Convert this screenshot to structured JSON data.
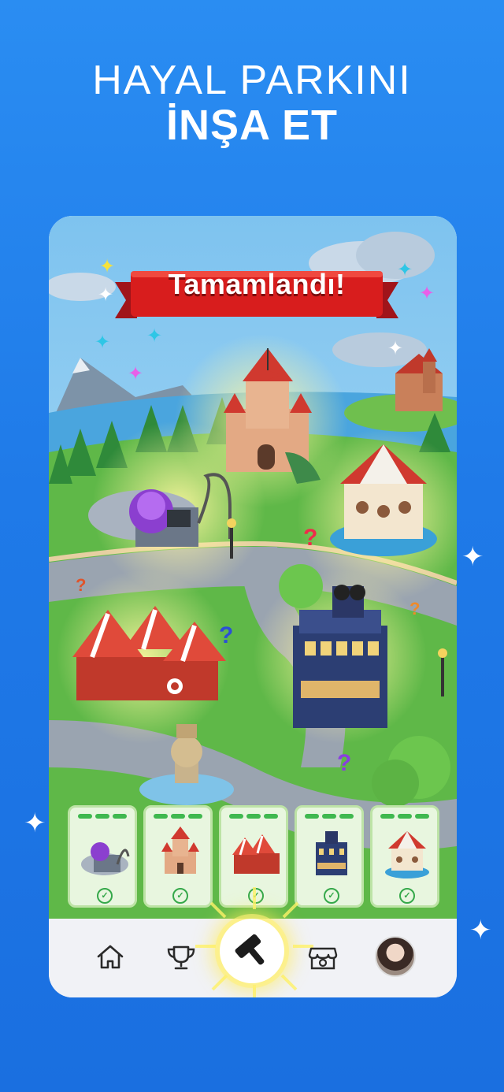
{
  "headline": {
    "line1": "HAYAL PARKINI",
    "line2": "İNŞA ET"
  },
  "game": {
    "banner_text": "Tamamlandı!",
    "question_mark": "?"
  },
  "cards": [
    {
      "name": "Bilim Laboratuvarı",
      "status": "completed"
    },
    {
      "name": "Kale",
      "status": "completed"
    },
    {
      "name": "Sirk Çadırları",
      "status": "completed"
    },
    {
      "name": "Sinema Binası",
      "status": "completed"
    },
    {
      "name": "Atlıkarınca",
      "status": "completed"
    }
  ],
  "navbar": {
    "items": [
      "home-icon",
      "trophy-icon",
      "hammer-icon",
      "shop-icon",
      "avatar"
    ],
    "active": "hammer-icon"
  },
  "colors": {
    "background": "#1f7ae8",
    "banner_red": "#d81d1d",
    "card_bg": "#e8f6df",
    "check_green": "#35a84a",
    "navbar_bg": "#f1f2f6"
  }
}
